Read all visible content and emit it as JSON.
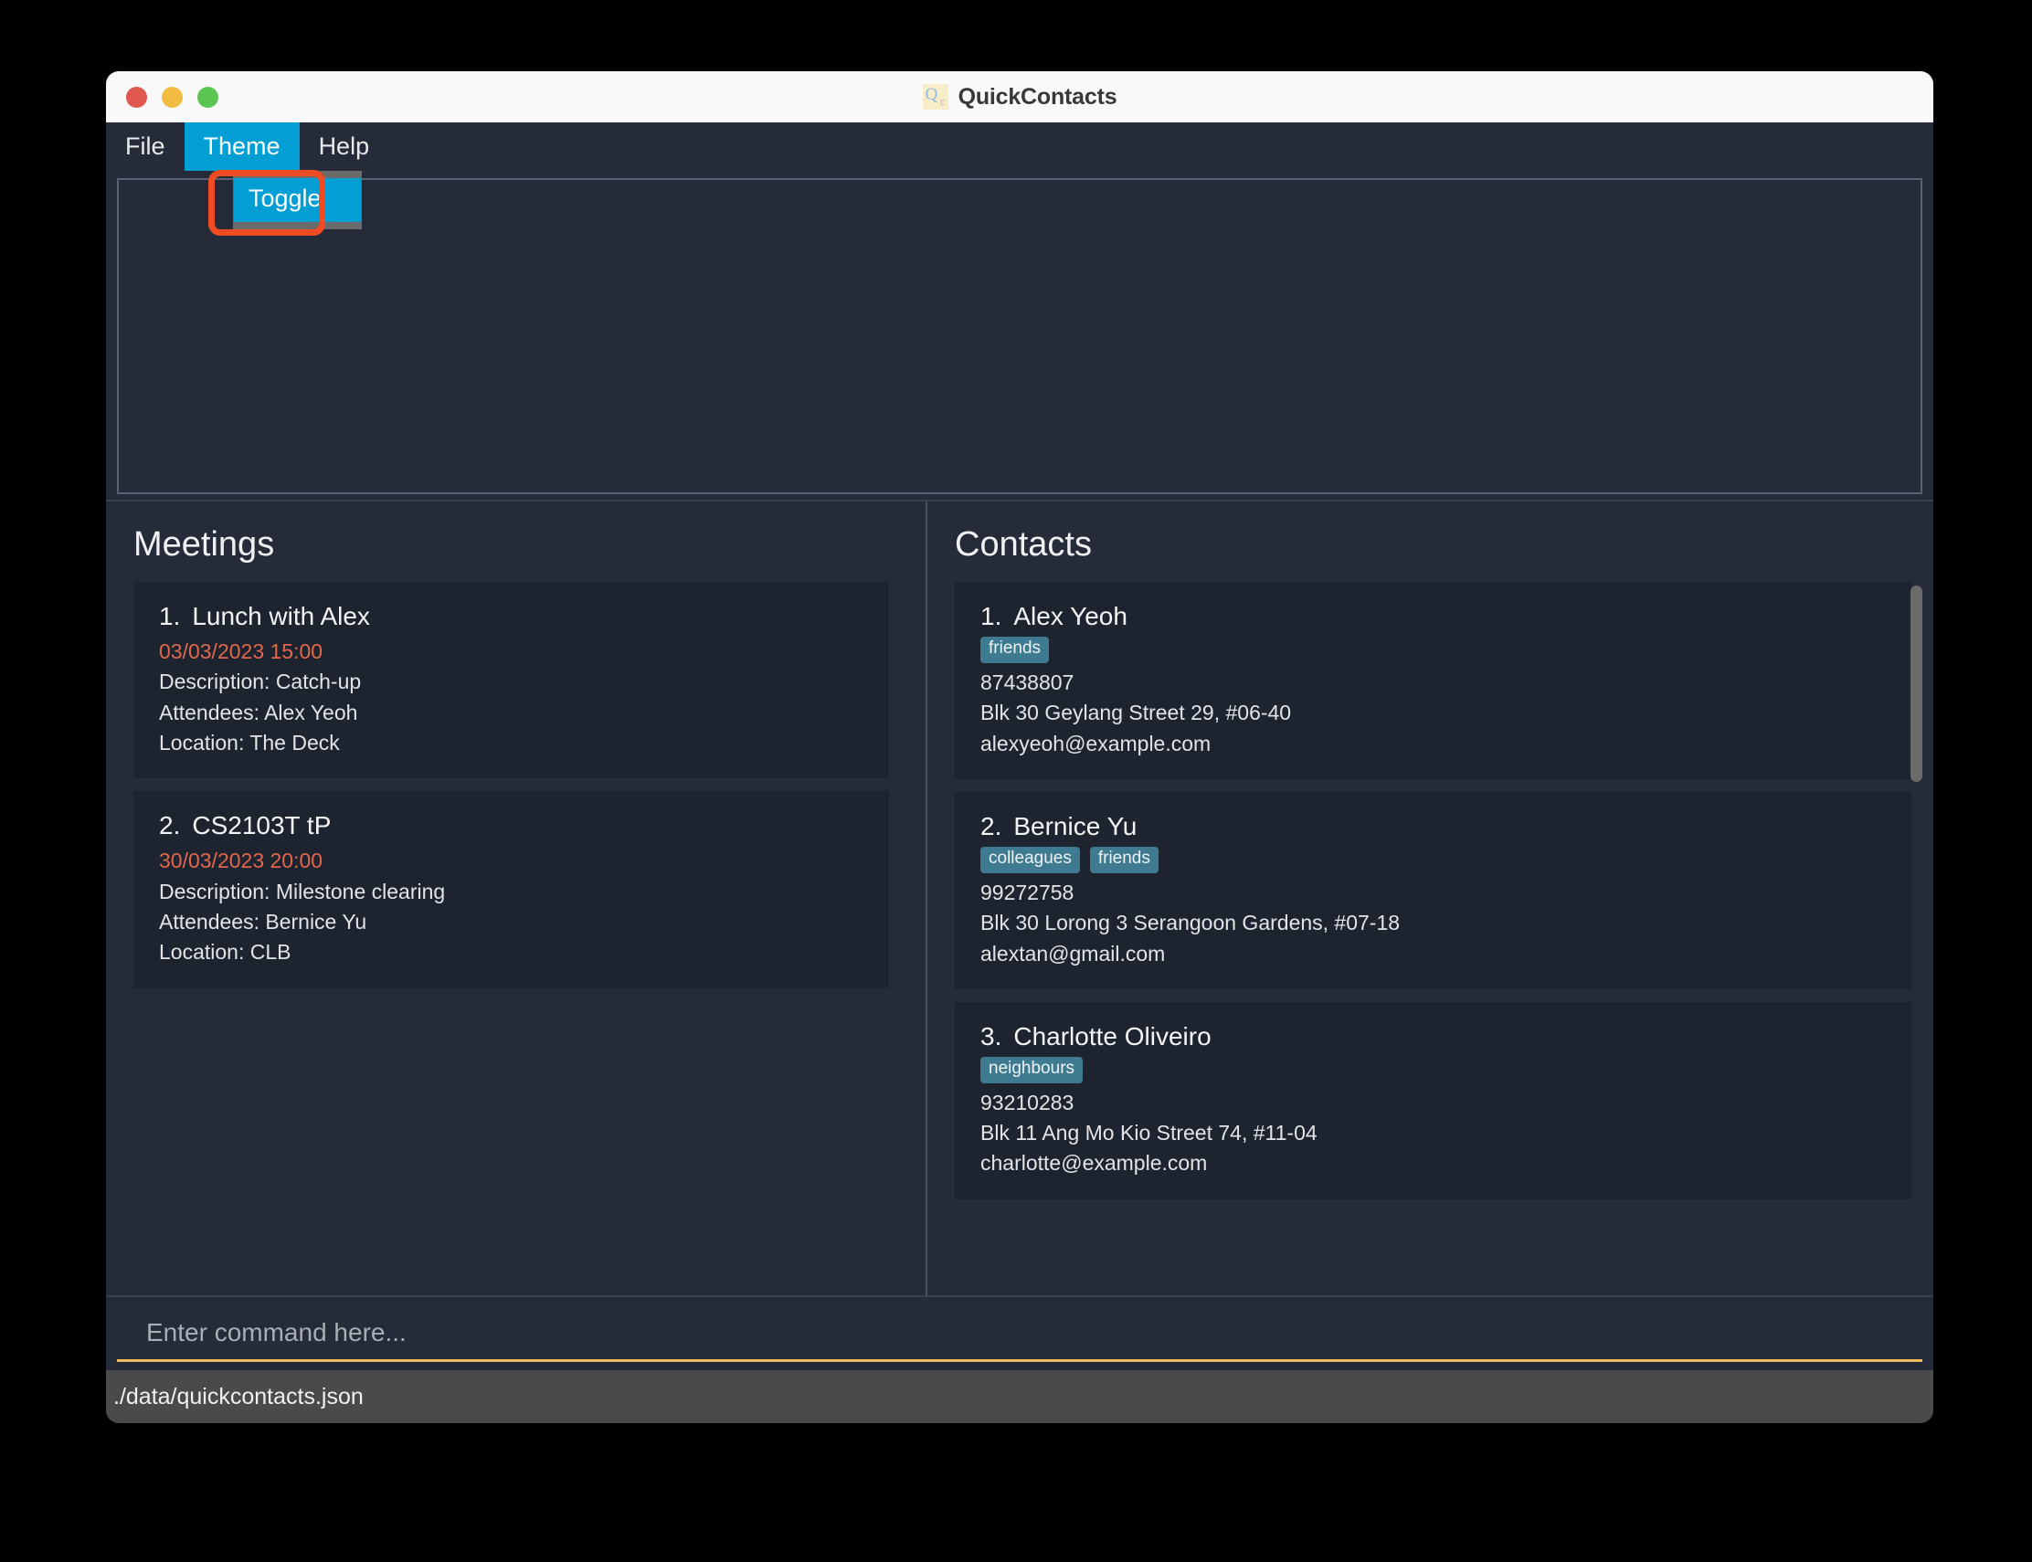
{
  "window": {
    "title": "QuickContacts",
    "app_icon": "quickcontacts-icon",
    "icon_letter_primary": "Q",
    "icon_letter_secondary": "c",
    "traffic_lights": {
      "close_color": "#e0574f",
      "minimize_color": "#f2bc42",
      "maximize_color": "#5bc552"
    }
  },
  "menubar": {
    "items": [
      {
        "label": "File",
        "active": false
      },
      {
        "label": "Theme",
        "active": true
      },
      {
        "label": "Help",
        "active": false
      }
    ],
    "accent_color": "#039ed3"
  },
  "dropdown": {
    "open_for": "Theme",
    "items": [
      {
        "label": "Toggle",
        "highlighted": true
      }
    ],
    "annotation_color": "#f04c23"
  },
  "result_display": {
    "content": "",
    "border_color": "#5a6172"
  },
  "meetings": {
    "title": "Meetings",
    "items": [
      {
        "index": "1.",
        "name": "Lunch with Alex",
        "datetime": "03/03/2023 15:00",
        "description": "Description: Catch-up",
        "attendees": "Attendees: Alex Yeoh",
        "location": "Location: The Deck"
      },
      {
        "index": "2.",
        "name": "CS2103T tP",
        "datetime": "30/03/2023 20:00",
        "description": "Description: Milestone clearing",
        "attendees": "Attendees: Bernice Yu",
        "location": "Location: CLB"
      }
    ],
    "datetime_color": "#e0684c"
  },
  "contacts": {
    "title": "Contacts",
    "tag_color": "#3e7b91",
    "items": [
      {
        "index": "1.",
        "name": "Alex Yeoh",
        "tags": [
          "friends"
        ],
        "phone": "87438807",
        "address": "Blk 30 Geylang Street 29, #06-40",
        "email": "alexyeoh@example.com"
      },
      {
        "index": "2.",
        "name": "Bernice Yu",
        "tags": [
          "colleagues",
          "friends"
        ],
        "phone": "99272758",
        "address": "Blk 30 Lorong 3 Serangoon Gardens, #07-18",
        "email": "alextan@gmail.com"
      },
      {
        "index": "3.",
        "name": "Charlotte Oliveiro",
        "tags": [
          "neighbours"
        ],
        "phone": "93210283",
        "address": "Blk 11 Ang Mo Kio Street 74, #11-04",
        "email": "charlotte@example.com"
      }
    ]
  },
  "command": {
    "value": "",
    "placeholder": "Enter command here...",
    "underline_color": "#f0b95a"
  },
  "statusbar": {
    "text": "./data/quickcontacts.json"
  }
}
